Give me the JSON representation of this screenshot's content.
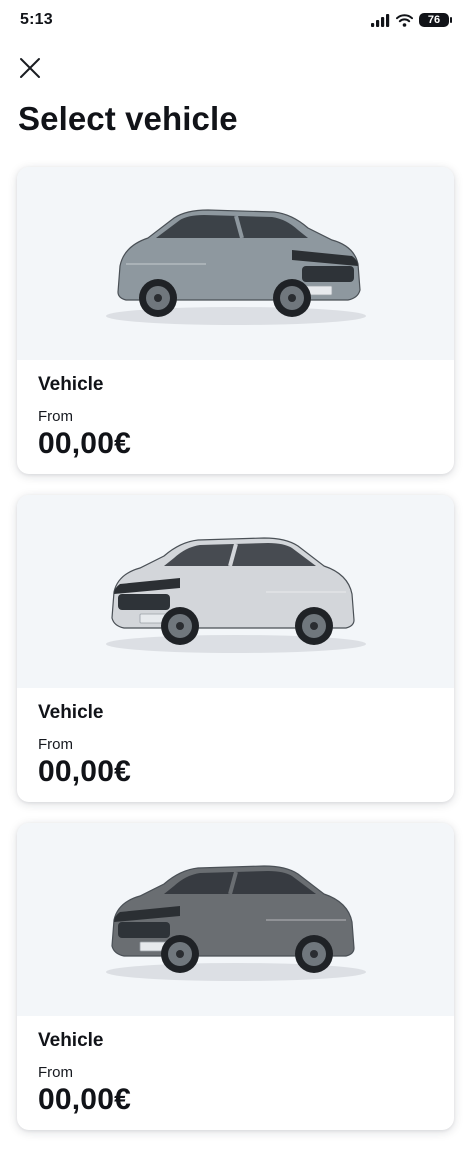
{
  "status_bar": {
    "time": "5:13",
    "battery": "76"
  },
  "header": {
    "title": "Select vehicle"
  },
  "vehicles": [
    {
      "name": "Vehicle",
      "from_label": "From",
      "price": "00,00€",
      "color": "#8e989f",
      "orientation": "right"
    },
    {
      "name": "Vehicle",
      "from_label": "From",
      "price": "00,00€",
      "color": "#d3d6da",
      "orientation": "left"
    },
    {
      "name": "Vehicle",
      "from_label": "From",
      "price": "00,00€",
      "color": "#6a6e72",
      "orientation": "left"
    }
  ]
}
